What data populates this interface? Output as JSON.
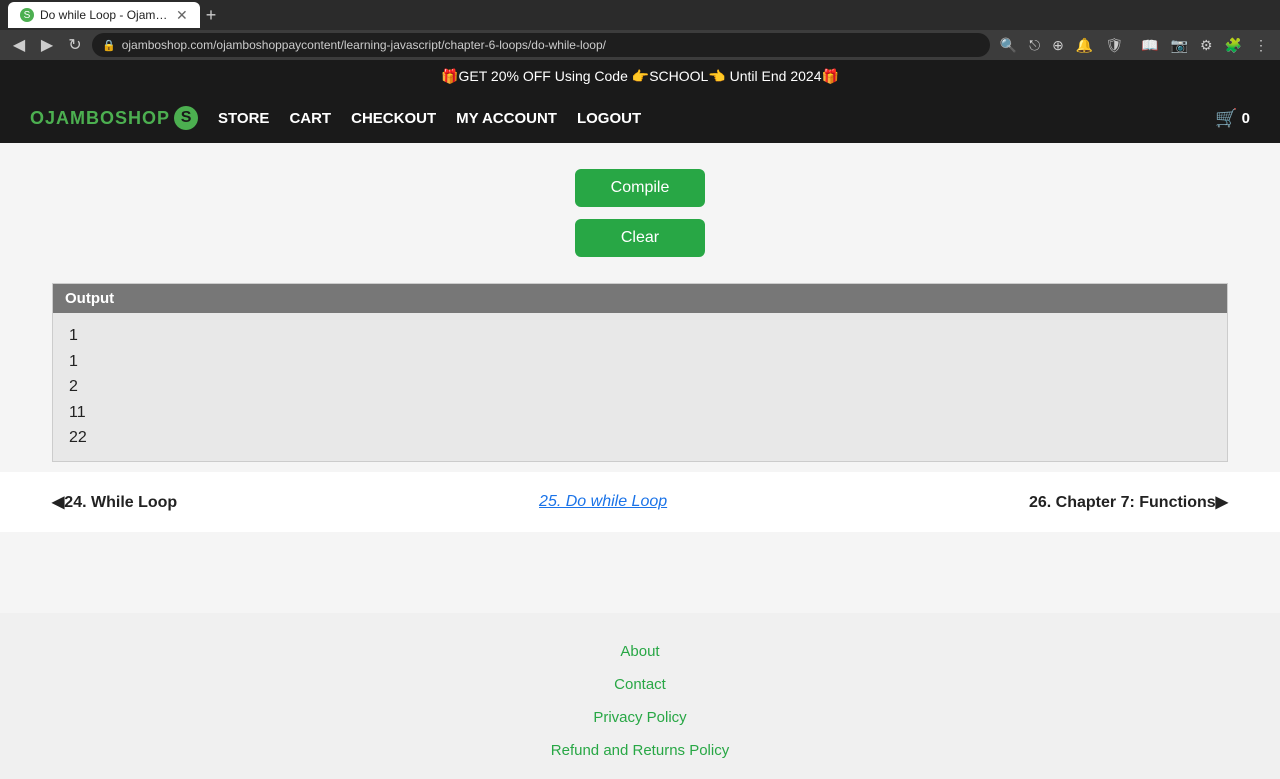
{
  "browser": {
    "tab_title": "Do while Loop - OjamboSh...",
    "url": "ojamboshop.com/ojamboshoppaycontent/learning-javascript/chapter-6-loops/do-while-loop/",
    "back_btn": "◀",
    "forward_btn": "▶",
    "reload_btn": "↻"
  },
  "promo": {
    "text": "🎁GET 20% OFF Using Code 👉SCHOOL👈 Until End 2024🎁"
  },
  "nav": {
    "logo_text": "OJAMBOSHOP",
    "logo_s": "S",
    "store": "STORE",
    "cart": "CART",
    "checkout": "CHECKOUT",
    "my_account": "MY ACCOUNT",
    "logout": "LOGOUT",
    "cart_icon": "🛒",
    "cart_count": "0"
  },
  "buttons": {
    "compile": "Compile",
    "clear": "Clear"
  },
  "output": {
    "header": "Output",
    "lines": [
      "1",
      "1",
      "2",
      "11",
      "22"
    ]
  },
  "page_navigation": {
    "prev_label": "◀24. While Loop",
    "current_label": "25. Do while Loop",
    "next_label": "26. Chapter 7: Functions▶"
  },
  "footer": {
    "links": [
      "About",
      "Contact",
      "Privacy Policy",
      "Refund and Returns Policy"
    ]
  }
}
